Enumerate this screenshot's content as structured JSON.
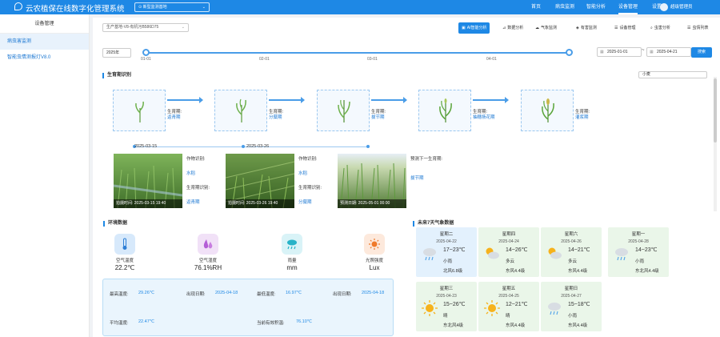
{
  "header": {
    "app_title": "云农植保在线数字化管理系统",
    "site": "新型监测基地",
    "nav": [
      "首页",
      "病虫监测",
      "智能分析",
      "设备管理",
      "设置"
    ],
    "active_nav": "设备管理",
    "user": "超级管理员"
  },
  "sidebar": {
    "title": "设备管理",
    "items": [
      {
        "label": "病虫害监测",
        "active": true
      },
      {
        "label": "智能虫情测报灯V8.0",
        "active": false
      }
    ]
  },
  "toolbar": {
    "device": "生产基地-V8-有机污B586D75",
    "tabs": [
      "AI智能分析",
      "数据分析",
      "气象监测",
      "有害监测",
      "设备管理",
      "虫害分析",
      "虫情列表"
    ],
    "active_tab": "AI智能分析"
  },
  "filter": {
    "year": "2025年",
    "timeline_labels": [
      "01-01",
      "02-01",
      "03-01",
      "04-01"
    ],
    "start_date": "2025-01-01",
    "end_date": "2025-04-21",
    "search": "搜索",
    "range_sep": "~"
  },
  "growth": {
    "title": "生育期识别",
    "top_select": "小麦",
    "stage_label": "生育期:",
    "stages": [
      "返青期",
      "分蘖期",
      "拔节期",
      "抽穗扬花期",
      "灌浆期"
    ],
    "photo_dates": [
      "2025-03-15",
      "2025-03-26"
    ],
    "photos": [
      {
        "caption": "拍摄时间: 2025-03-15 19:40",
        "crop_label": "作物识别:",
        "crop": "水稻",
        "stage_label": "生育期识别:",
        "stage": "返青期"
      },
      {
        "caption": "拍摄时间: 2025-03-26 19:40",
        "crop_label": "作物识别:",
        "crop": "水稻",
        "stage_label": "生育期识别:",
        "stage": "分蘖期"
      },
      {
        "caption": "预测日期: 2025-05-01 00:00",
        "next_label": "预测下一生育期:",
        "next": "拔节期"
      }
    ]
  },
  "environment": {
    "title": "环境数据",
    "items": [
      {
        "label": "空气温度",
        "value": "22.2℃",
        "icon": "thermometer-icon",
        "color": "#d7e9fb"
      },
      {
        "label": "空气湿度",
        "value": "76.1%RH",
        "icon": "humidity-icon",
        "color": "#f1e1f7"
      },
      {
        "label": "雨量",
        "value": "mm",
        "icon": "rain-icon",
        "color": "#d9f3f7"
      },
      {
        "label": "光照强度",
        "value": "Lux",
        "icon": "sun-icon",
        "color": "#fde9dc"
      }
    ],
    "stats": {
      "max_temp_label": "最高温度:",
      "max_temp": "29.26℃",
      "max_date_label": "出现日期:",
      "max_date": "2025-04-18",
      "min_temp_label": "最低温度:",
      "min_temp": "16.97℃",
      "min_date_label": "出现日期:",
      "min_date": "2025-04-18",
      "avg_temp_label": "平均温度:",
      "avg_temp": "22.47℃",
      "acc_label": "当前有效积温:",
      "acc": "76.10℃"
    }
  },
  "weather": {
    "title": "未来7天气象数据",
    "days": [
      {
        "day": "星期二",
        "date": "2025-04-22",
        "temp": "17~23℃",
        "cond": "小雨",
        "wind": "北风6.8级",
        "icon": "rain-cloud-icon",
        "tone": "blue"
      },
      {
        "day": "星期四",
        "date": "2025-04-24",
        "temp": "14~26℃",
        "cond": "多云",
        "wind": "东风4.4级",
        "icon": "partly-cloudy-icon",
        "tone": "green"
      },
      {
        "day": "星期六",
        "date": "2025-04-26",
        "temp": "14~21℃",
        "cond": "多云",
        "wind": "东风4.4级",
        "icon": "partly-cloudy-icon",
        "tone": "green"
      },
      {
        "day": "星期一",
        "date": "2025-04-28",
        "temp": "14~23℃",
        "cond": "小雨",
        "wind": "东北风4.4级",
        "icon": "rain-cloud-icon",
        "tone": "green"
      },
      {
        "day": "星期三",
        "date": "2025-04-23",
        "temp": "15~26℃",
        "cond": "晴",
        "wind": "东北风4级",
        "icon": "sunny-icon",
        "tone": "green"
      },
      {
        "day": "星期五",
        "date": "2025-04-25",
        "temp": "12~21℃",
        "cond": "晴",
        "wind": "东风4.4级",
        "icon": "sunny-icon",
        "tone": "green"
      },
      {
        "day": "星期日",
        "date": "2025-04-27",
        "temp": "15~18℃",
        "cond": "小雨",
        "wind": "东风4.4级",
        "icon": "rain-cloud-icon",
        "tone": "green"
      }
    ]
  },
  "colors": {
    "primary": "#1e88e5",
    "link": "#1976d2"
  }
}
